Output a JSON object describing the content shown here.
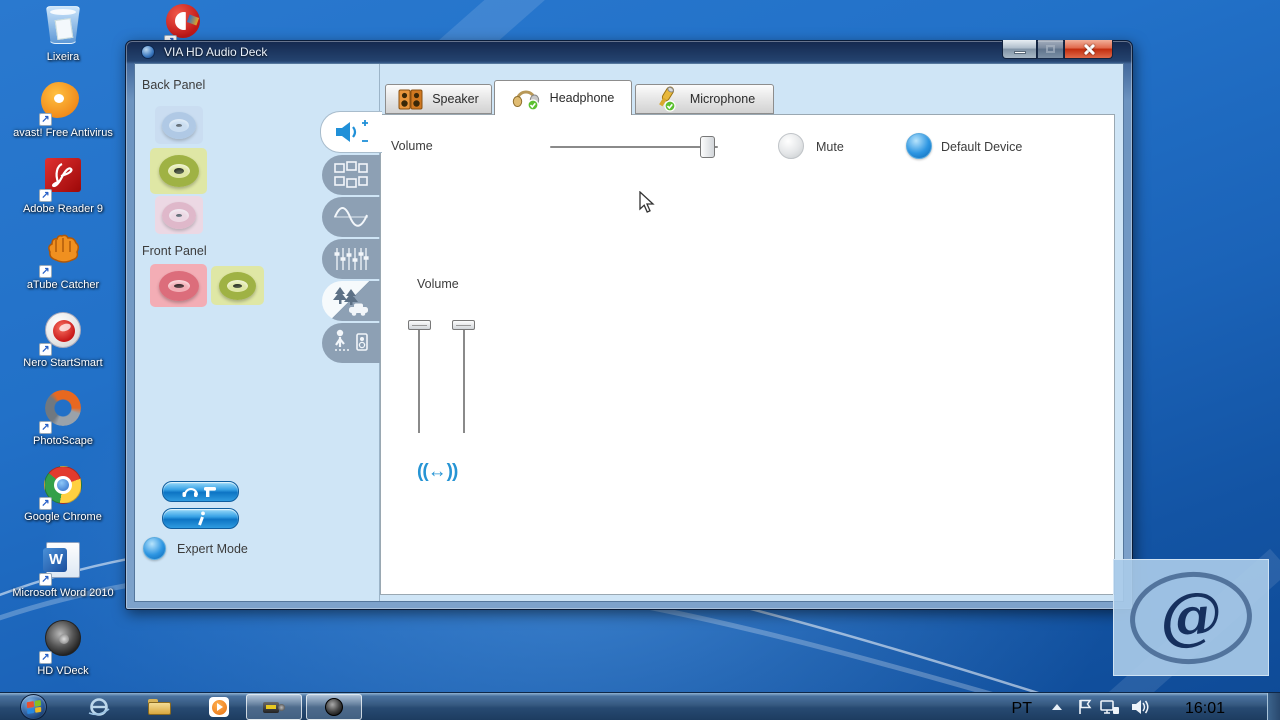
{
  "desktop": {
    "icons": [
      {
        "label": "Lixeira"
      },
      {
        "label": "avast! Free Antivirus"
      },
      {
        "label": "Adobe Reader 9"
      },
      {
        "label": "aTube Catcher"
      },
      {
        "label": "Nero StartSmart"
      },
      {
        "label": "PhotoScape"
      },
      {
        "label": "Google Chrome"
      },
      {
        "label": "Microsoft Word 2010"
      },
      {
        "label": "HD VDeck"
      }
    ],
    "watermark_symbol": "@"
  },
  "window": {
    "title": "VIA HD Audio Deck",
    "back_panel_label": "Back Panel",
    "front_panel_label": "Front Panel",
    "tabs": [
      {
        "label": "Speaker",
        "active": false
      },
      {
        "label": "Headphone",
        "active": true
      },
      {
        "label": "Microphone",
        "active": false
      }
    ],
    "headphone_page": {
      "volume_label": "Volume",
      "volume_pct": 95,
      "mute_label": "Mute",
      "mute_on": false,
      "default_device_label": "Default Device",
      "default_device_on": true,
      "channels_volume_label": "Volume",
      "channel_slider_pcts": [
        100,
        100
      ]
    },
    "expert_mode_label": "Expert Mode"
  },
  "taskbar": {
    "language": "PT",
    "time": "16:01"
  },
  "colors": {
    "accent_blue": "#2090d8",
    "glossy_button_blue": "#1f8fde",
    "jack_green": "#a2b43e",
    "jack_red": "#dd6f7d",
    "jack_blue": "#a8c4e4",
    "jack_pink": "#e4aec2",
    "taskbar_blue": "#35587f",
    "close_button_red": "#c22d0e"
  }
}
